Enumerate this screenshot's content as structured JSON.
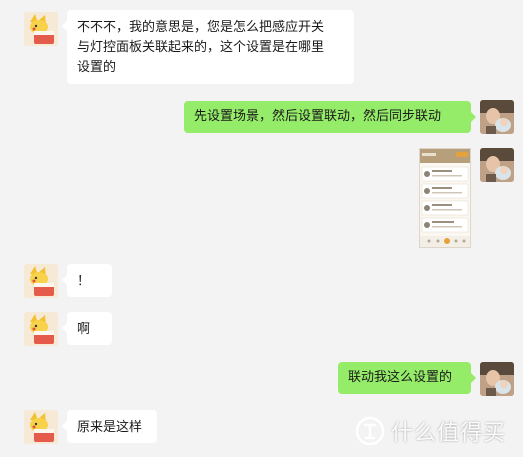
{
  "messages": [
    {
      "side": "in",
      "text": "不不不，我的意思是，您是怎么把感应开关\n与灯控面板关联起来的，这个设置是在哪里\n设置的"
    },
    {
      "side": "out",
      "text": "先设置场景，然后设置联动，然后同步联动"
    },
    {
      "side": "out",
      "type": "image"
    },
    {
      "side": "in",
      "text": "！"
    },
    {
      "side": "in",
      "text": "啊"
    },
    {
      "side": "out",
      "text": "联动我这么设置的"
    },
    {
      "side": "in",
      "text": "原来是这样"
    }
  ],
  "watermark": {
    "text": "什么值得买",
    "icon": "smzdm-logo-icon"
  },
  "colors": {
    "outgoing_bubble": "#95ec69",
    "incoming_bubble": "#ffffff",
    "background": "#f3f3f3"
  }
}
